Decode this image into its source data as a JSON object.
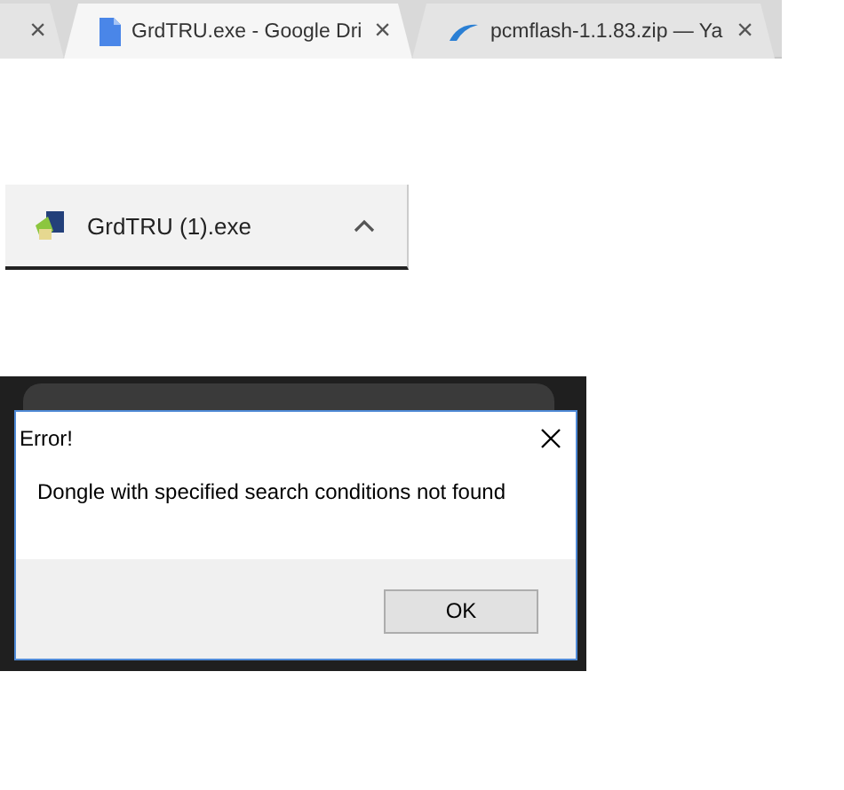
{
  "tabs": [
    {
      "kind": "partial",
      "selected": false,
      "close": "×"
    },
    {
      "kind": "document",
      "title": "GrdTRU.exe - Google Dri",
      "selected": true,
      "close": "×"
    },
    {
      "kind": "swoosh",
      "title": "pcmflash-1.1.83.zip — Ya",
      "selected": false,
      "close": "×"
    }
  ],
  "download": {
    "file_name": "GrdTRU (1).exe"
  },
  "dialog": {
    "title": "Error!",
    "message": "Dongle with specified search conditions not found",
    "buttons": [
      "OK"
    ]
  }
}
